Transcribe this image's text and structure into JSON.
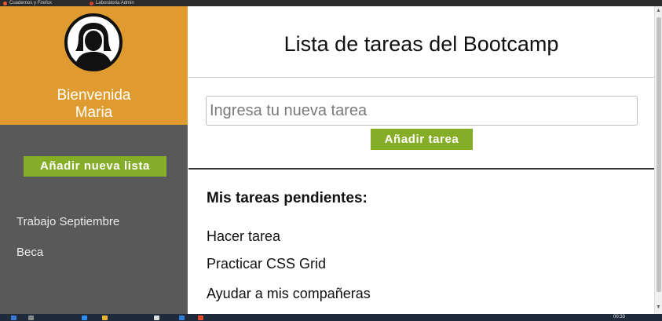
{
  "browser": {
    "tabs": [
      {
        "label": "Cuadernos y Firefox"
      },
      {
        "label": "Laboratoria Admin"
      }
    ]
  },
  "sidebar": {
    "greeting": "Bienvenida",
    "user_name": "Maria",
    "add_list_label": "Añadir nueva lista",
    "lists": [
      {
        "label": "Trabajo Septiembre"
      },
      {
        "label": "Beca"
      }
    ]
  },
  "main": {
    "title": "Lista de tareas del Bootcamp",
    "task_input": {
      "value": "",
      "placeholder": "Ingresa tu nueva tarea"
    },
    "add_task_label": "Añadir tarea",
    "pending_heading": "Mis tareas pendientes:",
    "tasks": [
      {
        "label": "Hacer tarea"
      },
      {
        "label": "Practicar CSS Grid"
      },
      {
        "label": "Ayudar a mis compañeras"
      }
    ]
  },
  "taskbar": {
    "clock": "00:33"
  },
  "colors": {
    "sidebar_header": "#df9b30",
    "sidebar_body": "#595959",
    "button_green": "#85ad28"
  },
  "icons": {
    "avatar": "user-avatar-icon",
    "scroll_up": "chevron-up-icon",
    "scroll_down": "chevron-down-icon"
  }
}
